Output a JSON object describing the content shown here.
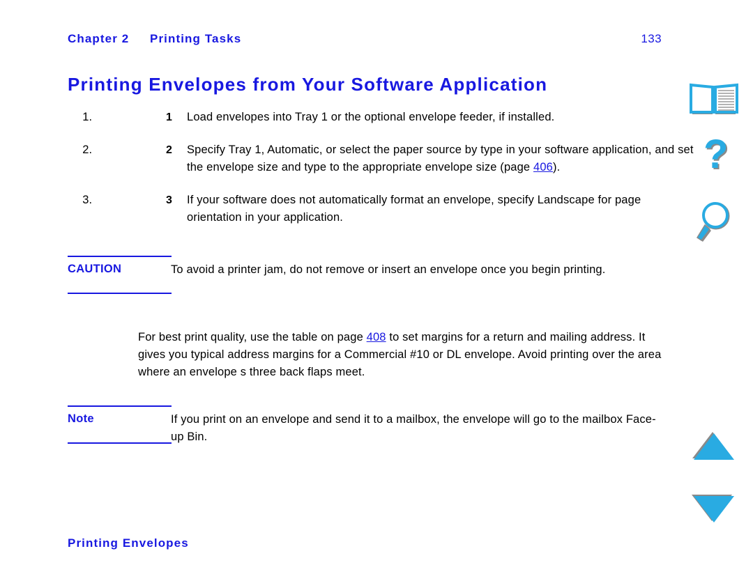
{
  "header": {
    "chapter_label": "Chapter 2",
    "chapter_title": "Printing Tasks",
    "page_number": "133"
  },
  "title": "Printing Envelopes from Your Software Application",
  "steps": [
    {
      "number": "1",
      "text": "Load envelopes into Tray 1 or the optional envelope feeder, if installed."
    },
    {
      "number": "2",
      "text_before": "Specify Tray 1, Automatic, or select the paper source by type in your software application, and set the envelope size and type to the appropriate envelope size (page ",
      "link": "406",
      "text_after": ")."
    },
    {
      "number": "3",
      "text": "If your software does not automatically format an envelope, specify Landscape for page orientation in your application."
    }
  ],
  "caution": {
    "label": "CAUTION",
    "text": "To avoid a printer jam, do not remove or insert an envelope once you begin printing."
  },
  "paragraph": {
    "text_before": "For best print quality, use the table on page ",
    "link": "408",
    "text_after": " to set margins for a return and mailing address. It gives you typical address margins for a Commercial #10 or DL envelope. Avoid printing over the area where an envelope s three back flaps meet."
  },
  "note": {
    "label": "Note",
    "text": "If you print on an envelope and send it to a mailbox, the envelope will go to the mailbox Face-up Bin."
  },
  "footer": {
    "text": "Printing Envelopes"
  },
  "nav_icons": [
    {
      "name": "open-book-icon",
      "tooltip": "Contents"
    },
    {
      "name": "question-mark-icon",
      "tooltip": "Help"
    },
    {
      "name": "magnifier-icon",
      "tooltip": "Search"
    },
    {
      "name": "triangle-up-icon",
      "tooltip": "Previous page"
    },
    {
      "name": "triangle-down-icon",
      "tooltip": "Next page"
    }
  ],
  "colors": {
    "link_blue": "#1818e0",
    "heading_blue": "#1818e0",
    "icon_cyan": "#29ABE2",
    "icon_shadow": "#808080",
    "text_black": "#000000",
    "page_background": "#ffffff"
  }
}
